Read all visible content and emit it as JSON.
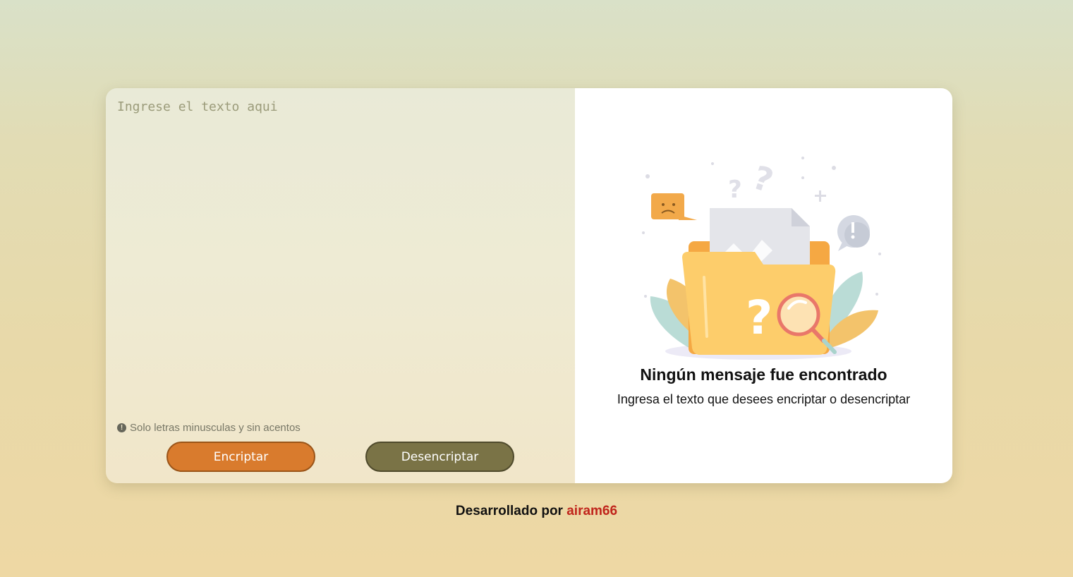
{
  "input": {
    "placeholder": "Ingrese el texto aqui",
    "value": ""
  },
  "notice": {
    "icon": "exclamation-circle-icon",
    "text": "Solo letras minusculas y sin acentos"
  },
  "buttons": {
    "encrypt_label": "Encriptar",
    "decrypt_label": "Desencriptar",
    "encrypt_color": "#d97b2d",
    "decrypt_color": "#7a7346"
  },
  "output": {
    "illustration": "empty-folder-search-illustration",
    "title": "Ningún mensaje fue encontrado",
    "subtitle": "Ingresa el texto que desees encriptar o desencriptar"
  },
  "footer": {
    "prefix": "Desarrollado por",
    "author": "airam66",
    "author_color": "#c0251c"
  }
}
